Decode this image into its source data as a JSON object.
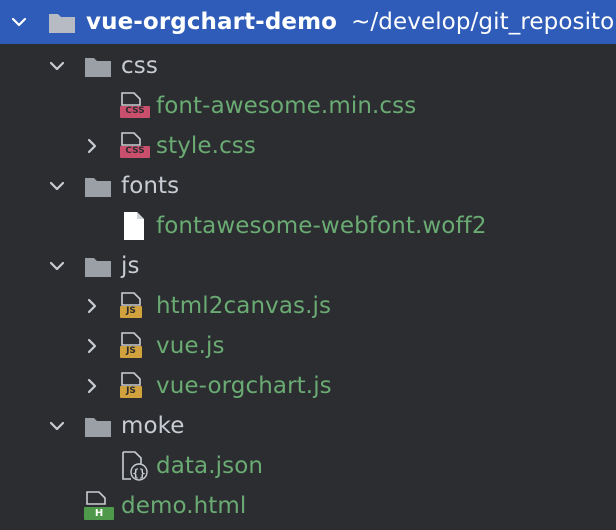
{
  "root": {
    "name": "vue-orgchart-demo",
    "path": "~/develop/git_reposito"
  },
  "items": [
    {
      "label": "css"
    },
    {
      "label": "font-awesome.min.css",
      "badge": "CSS"
    },
    {
      "label": "style.css",
      "badge": "CSS"
    },
    {
      "label": "fonts"
    },
    {
      "label": "fontawesome-webfont.woff2"
    },
    {
      "label": "js"
    },
    {
      "label": "html2canvas.js",
      "badge": "JS"
    },
    {
      "label": "vue.js",
      "badge": "JS"
    },
    {
      "label": "vue-orgchart.js",
      "badge": "JS"
    },
    {
      "label": "moke"
    },
    {
      "label": "data.json"
    },
    {
      "label": "demo.html",
      "badge": "H"
    }
  ],
  "colors": {
    "background": "#2b2d30",
    "selection": "#2e5cb8",
    "file_text": "#6aab73",
    "folder_text": "#c9cdd3",
    "folder_icon": "#9aa0a6",
    "css_badge": "#c94f6d",
    "js_badge": "#d1a23e",
    "html_badge": "#4e9a4a"
  },
  "icons": {
    "folder": "folder-icon",
    "expanded": "chevron-down-icon",
    "collapsed": "chevron-right-icon",
    "css_file": "css-file-icon",
    "js_file": "js-file-icon",
    "json_file": "json-file-icon",
    "html_file": "html-file-icon",
    "generic_file": "file-icon"
  }
}
